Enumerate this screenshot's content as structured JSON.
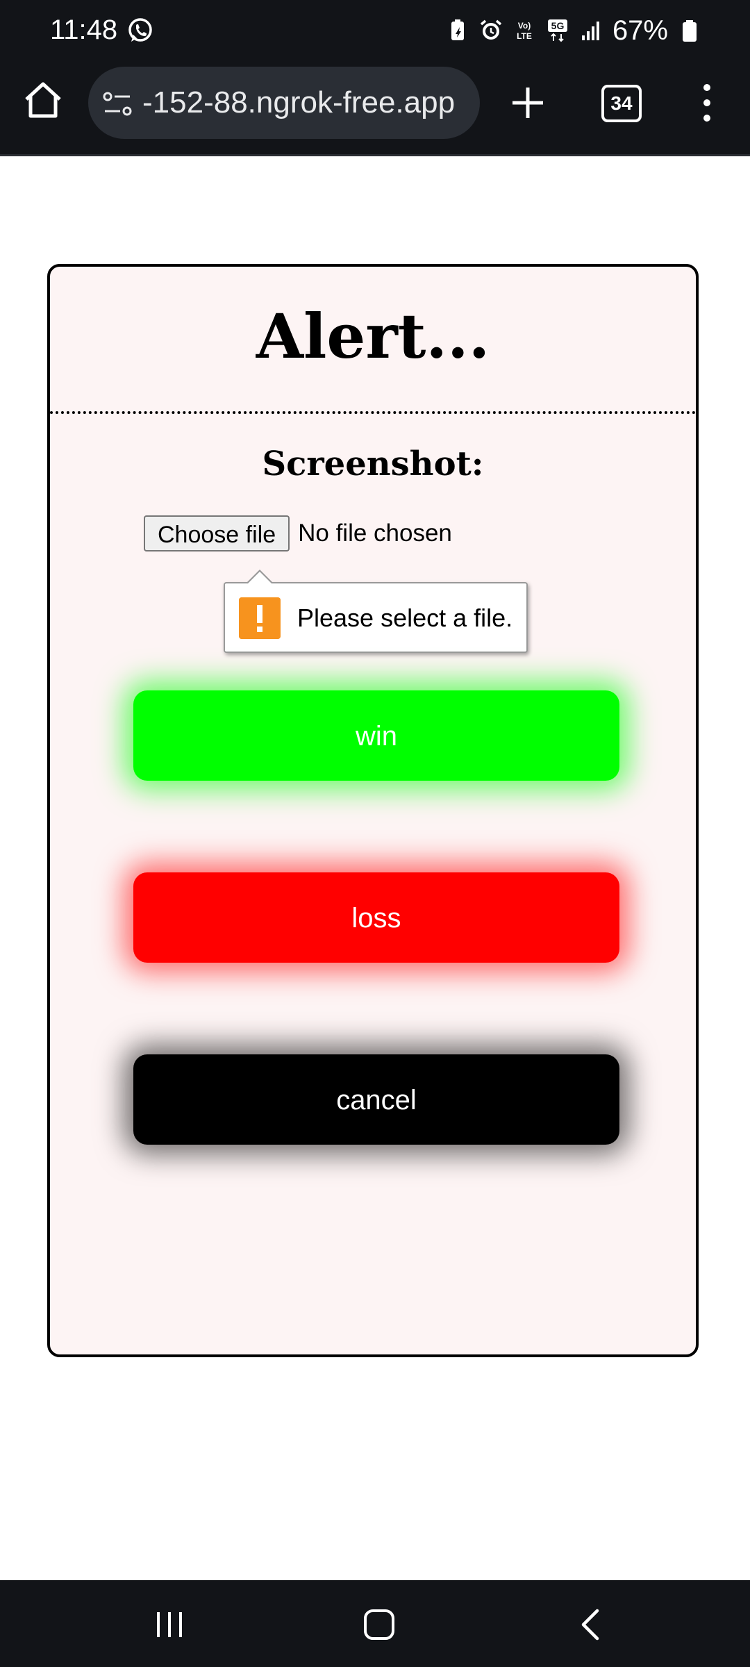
{
  "status_bar": {
    "time": "11:48",
    "battery_percent": "67%",
    "icons": [
      "whatsapp-icon",
      "battery-saver-icon",
      "alarm-icon",
      "volte-icon",
      "5g-icon",
      "signal-icon",
      "battery-icon"
    ],
    "volte_label": "Vo) LTE",
    "network_label": "5G"
  },
  "browser": {
    "url": "-152-88.ngrok-free.app",
    "tab_count": "34"
  },
  "dialog": {
    "title": "Alert...",
    "section_label": "Screenshot:",
    "file_input": {
      "button_label": "Choose file",
      "status_text": "No file chosen"
    },
    "validation_tooltip": "Please select a file.",
    "buttons": {
      "win": "win",
      "loss": "loss",
      "cancel": "cancel"
    }
  },
  "colors": {
    "win": "#00ff00",
    "loss": "#ff0000",
    "cancel": "#000000",
    "dialog_background": "#fdf4f4",
    "warning": "#f7931e"
  }
}
